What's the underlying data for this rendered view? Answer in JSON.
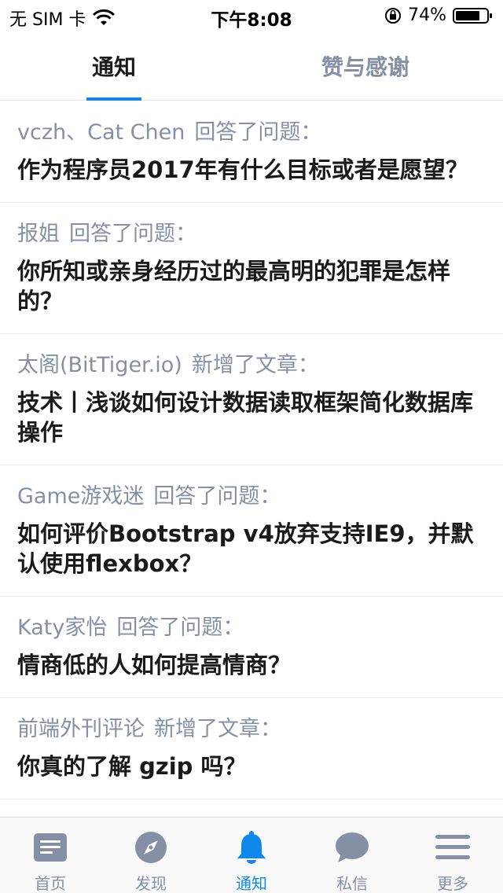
{
  "status_bar": {
    "carrier": "无 SIM 卡",
    "time": "下午8:08",
    "battery": "74%"
  },
  "top_tabs": [
    {
      "label": "通知",
      "active": true
    },
    {
      "label": "赞与感谢",
      "active": false
    }
  ],
  "feed": [
    {
      "actor": "vczh、Cat Chen",
      "action": "回答了问题：",
      "title": "作为程序员2017年有什么目标或者是愿望？"
    },
    {
      "actor": "报姐",
      "action": "回答了问题：",
      "title": "你所知或亲身经历过的最高明的犯罪是怎样的？"
    },
    {
      "actor": "太阁(BitTiger.io)",
      "action": "新增了文章：",
      "title": "技术丨浅谈如何设计数据读取框架简化数据库操作"
    },
    {
      "actor": "Game游戏迷",
      "action": "回答了问题：",
      "title": "如何评价Bootstrap v4放弃支持IE9，并默认使用flexbox？"
    },
    {
      "actor": "Katy家怡",
      "action": "回答了问题：",
      "title": "情商低的人如何提高情商？"
    },
    {
      "actor": "前端外刊评论",
      "action": "新增了文章：",
      "title": "你真的了解 gzip 吗？"
    }
  ],
  "bottom_tabs": [
    {
      "label": "首页",
      "icon": "home-feed-icon",
      "active": false
    },
    {
      "label": "发现",
      "icon": "compass-icon",
      "active": false
    },
    {
      "label": "通知",
      "icon": "bell-icon",
      "active": true
    },
    {
      "label": "私信",
      "icon": "chat-bubble-icon",
      "active": false
    },
    {
      "label": "更多",
      "icon": "menu-icon",
      "active": false
    }
  ],
  "colors": {
    "accent": "#0f88eb",
    "muted": "#8590a6",
    "title": "#1a1a1a"
  }
}
